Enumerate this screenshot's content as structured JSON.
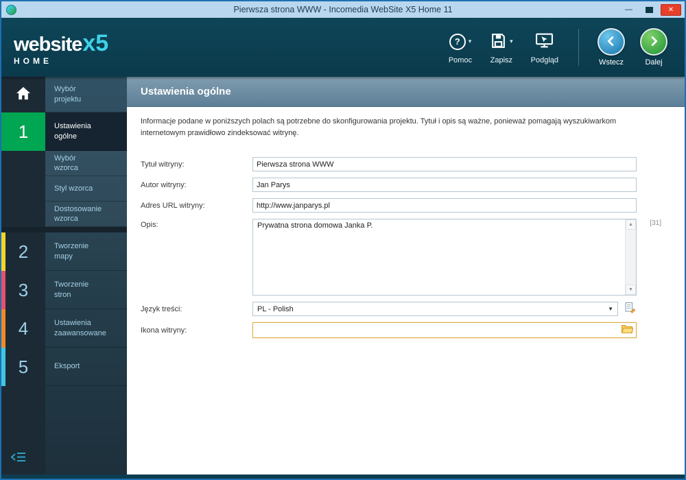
{
  "window": {
    "title": "Pierwsza strona WWW - Incomedia WebSite X5 Home 11"
  },
  "icons": {
    "help_glyph": "?",
    "menu_caret": "▾",
    "select_caret": "▼",
    "scroll_up": "▲",
    "scroll_down": "▼",
    "minimize_glyph": "—",
    "close_glyph": "✕"
  },
  "header": {
    "logo_main": "website",
    "logo_x5": "x5",
    "logo_sub": "HOME",
    "toolbar": [
      {
        "label": "Pomoc",
        "icon": "help-icon",
        "has_menu": true
      },
      {
        "label": "Zapisz",
        "icon": "save-icon",
        "has_menu": true
      },
      {
        "label": "Podgląd",
        "icon": "preview-icon",
        "has_menu": false
      }
    ],
    "back_label": "Wstecz",
    "next_label": "Dalej"
  },
  "sidebar": {
    "project_label": "Wybór projektu",
    "steps": [
      {
        "num": "1",
        "label": "Ustawienia ogólne",
        "color": "#00a651",
        "active": true
      },
      {
        "num": "2",
        "label": "Tworzenie mapy",
        "color": "#f5d327",
        "active": false
      },
      {
        "num": "3",
        "label": "Tworzenie stron",
        "color": "#e94f6b",
        "active": false
      },
      {
        "num": "4",
        "label": "Ustawienia zaawansowane",
        "color": "#f08a24",
        "active": false
      },
      {
        "num": "5",
        "label": "Eksport",
        "color": "#3fc6e0",
        "active": false
      }
    ],
    "substeps": [
      {
        "label": "Wybór wzorca"
      },
      {
        "label": "Styl wzorca"
      },
      {
        "label": "Dostosowanie wzorca"
      }
    ]
  },
  "content": {
    "title": "Ustawienia ogólne",
    "description": "Informacje podane w poniższych polach są potrzebne do skonfigurowania projektu. Tytuł i opis są ważne, ponieważ pomagają wyszukiwarkom internetowym prawidłowo zindeksować witrynę.",
    "form": {
      "site_title": {
        "label": "Tytuł witryny:",
        "value": "Pierwsza strona WWW"
      },
      "site_author": {
        "label": "Autor witryny:",
        "value": "Jan Parys"
      },
      "site_url": {
        "label": "Adres URL witryny:",
        "value": "http://www.janparys.pl"
      },
      "site_description": {
        "label": "Opis:",
        "value": "Prywatna strona domowa Janka P.",
        "counter": "[31]"
      },
      "language": {
        "label": "Język treści:",
        "value": "PL - Polish"
      },
      "site_icon": {
        "label": "Ikona witryny:",
        "value": ""
      }
    }
  },
  "colors": {
    "accent_green": "#00a651",
    "accent_cyan": "#3ed2e8",
    "header_bg": "#0c4052",
    "titlebar_bg": "#b9d7ee",
    "close_red": "#e8402a",
    "sidebar_dark": "#1c2a35"
  }
}
